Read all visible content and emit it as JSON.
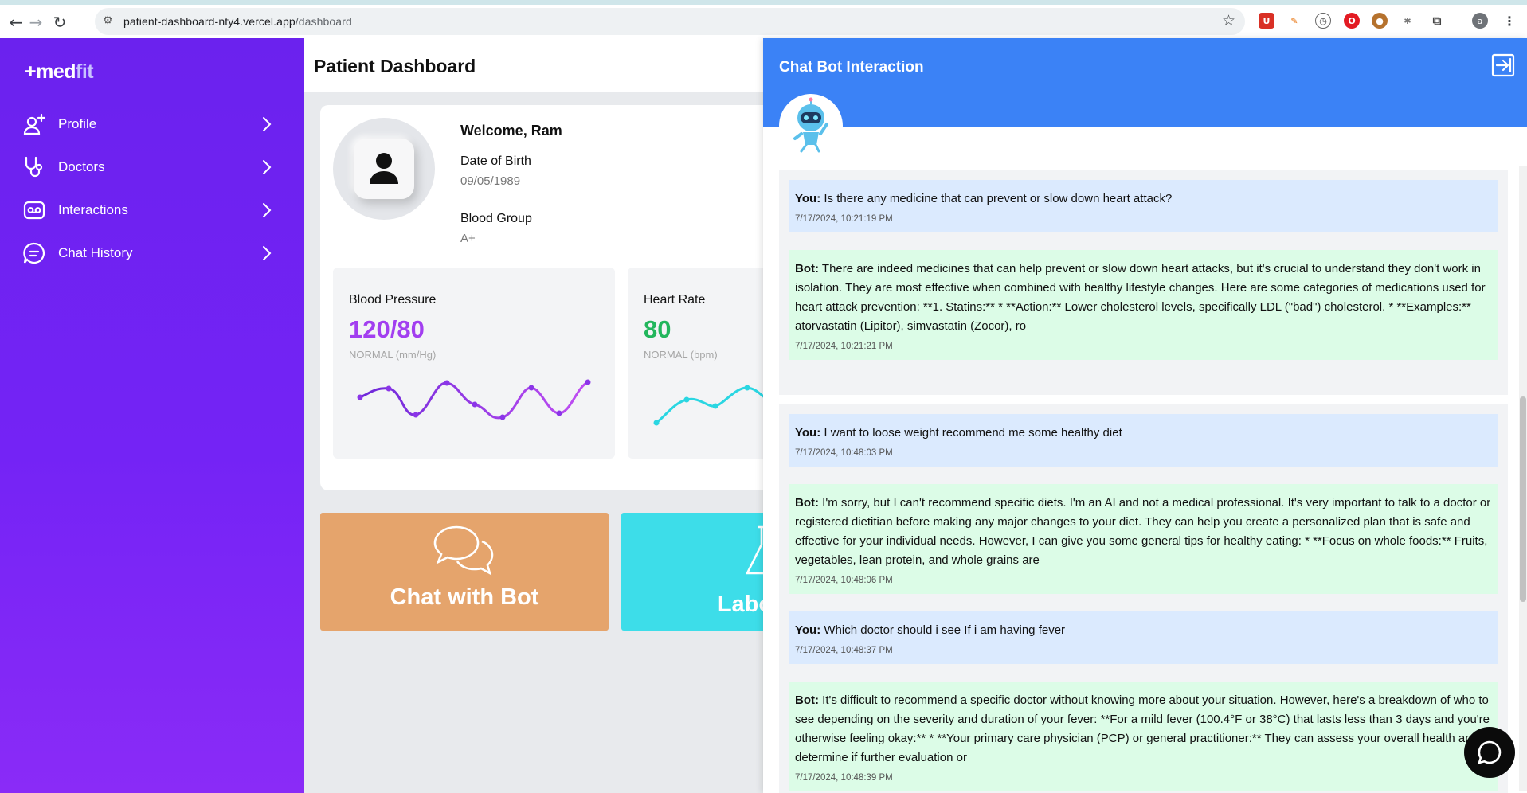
{
  "browser": {
    "url_host": "patient-dashboard-nty4.vercel.app",
    "url_path": "/dashboard",
    "profile_initial": "a"
  },
  "sidebar": {
    "logo_prefix": "+med",
    "logo_suffix": "fit",
    "items": [
      {
        "label": "Profile",
        "icon": "add-user-icon"
      },
      {
        "label": "Doctors",
        "icon": "stethoscope-icon"
      },
      {
        "label": "Interactions",
        "icon": "voicemail-icon"
      },
      {
        "label": "Chat History",
        "icon": "chat-bubble-icon"
      }
    ]
  },
  "dashboard": {
    "title": "Patient Dashboard",
    "welcome": "Welcome, Ram",
    "dob_label": "Date of Birth",
    "dob_value": "09/05/1989",
    "blood_group_label": "Blood Group",
    "blood_group_value": "A+",
    "metrics": [
      {
        "title": "Blood Pressure",
        "value": "120/80",
        "status": "NORMAL (mm/Hg)",
        "color": "#a23ef0"
      },
      {
        "title": "Heart Rate",
        "value": "80",
        "status": "NORMAL (bpm)",
        "color": "#22b65c"
      }
    ],
    "tiles": [
      {
        "label": "Chat with Bot",
        "color": "#e5a46c"
      },
      {
        "label": "Laborat",
        "color": "#3ddde9"
      }
    ]
  },
  "chat": {
    "title": "Chat Bot Interaction",
    "messages": [
      {
        "sender": "You:",
        "role": "you",
        "text": "Is there any medicine that can prevent or slow down heart attack?",
        "timestamp": "7/17/2024, 10:21:19 PM"
      },
      {
        "sender": "Bot:",
        "role": "bot",
        "text": "There are indeed medicines that can help prevent or slow down heart attacks, but it's crucial to understand they don't work in isolation. They are most effective when combined with healthy lifestyle changes. Here are some categories of medications used for heart attack prevention: **1. Statins:** * **Action:** Lower cholesterol levels, specifically LDL (\"bad\") cholesterol. * **Examples:** atorvastatin (Lipitor), simvastatin (Zocor), ro",
        "timestamp": "7/17/2024, 10:21:21 PM"
      },
      {
        "sender": "You:",
        "role": "you",
        "text": "I want to loose weight recommend me some healthy diet",
        "timestamp": "7/17/2024, 10:48:03 PM"
      },
      {
        "sender": "Bot:",
        "role": "bot",
        "text": "I'm sorry, but I can't recommend specific diets. I'm an AI and not a medical professional. It's very important to talk to a doctor or registered dietitian before making any major changes to your diet. They can help you create a personalized plan that is safe and effective for your individual needs. However, I can give you some general tips for healthy eating: * **Focus on whole foods:** Fruits, vegetables, lean protein, and whole grains are",
        "timestamp": "7/17/2024, 10:48:06 PM"
      },
      {
        "sender": "You:",
        "role": "you",
        "text": "Which doctor should i see If i am having fever",
        "timestamp": "7/17/2024, 10:48:37 PM"
      },
      {
        "sender": "Bot:",
        "role": "bot",
        "text": "It's difficult to recommend a specific doctor without knowing more about your situation. However, here's a breakdown of who to see depending on the severity and duration of your fever: **For a mild fever (100.4°F or 38°C) that lasts less than 3 days and you're otherwise feeling okay:** * **Your primary care physician (PCP) or general practitioner:** They can assess your overall health and determine if further evaluation or",
        "timestamp": "7/17/2024, 10:48:39 PM"
      }
    ]
  }
}
